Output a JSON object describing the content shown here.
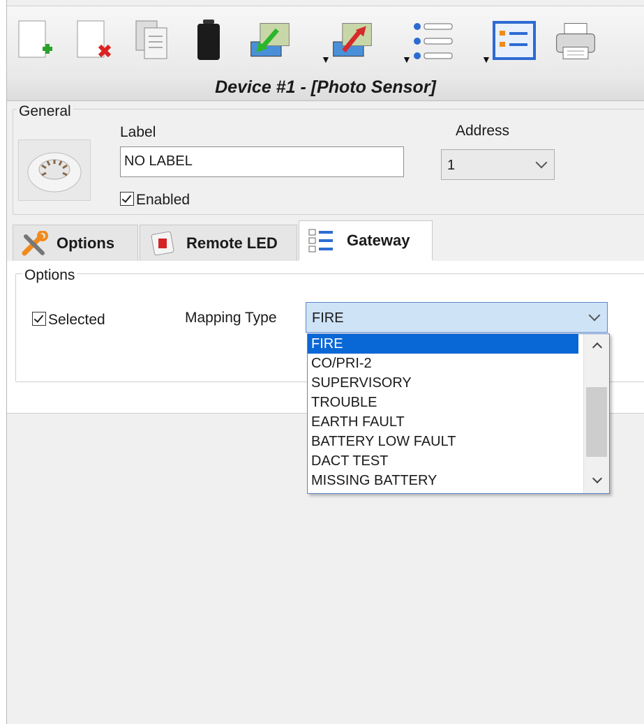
{
  "toolbar": {
    "buttons": [
      {
        "name": "new-device-icon"
      },
      {
        "name": "delete-device-icon"
      },
      {
        "name": "copy-icon"
      },
      {
        "name": "battery-icon"
      },
      {
        "name": "import-icon"
      },
      {
        "name": "export-icon"
      },
      {
        "name": "list-icon"
      },
      {
        "name": "form-view-icon"
      },
      {
        "name": "print-icon"
      }
    ]
  },
  "window_title": "Device #1 - [Photo Sensor]",
  "general": {
    "legend": "General",
    "label_caption": "Label",
    "label_value": "NO LABEL",
    "address_caption": "Address",
    "address_value": "1",
    "enabled_label": "Enabled",
    "enabled_checked": true
  },
  "tabs": [
    {
      "label": "Options",
      "icon": "tools-icon"
    },
    {
      "label": "Remote LED",
      "icon": "remote-led-icon"
    },
    {
      "label": "Gateway",
      "icon": "checklist-icon",
      "active": true
    }
  ],
  "options_group": {
    "legend": "Options",
    "selected_label": "Selected",
    "selected_checked": true,
    "mapping_type_label": "Mapping Type",
    "mapping_type_value": "FIRE",
    "mapping_options": [
      "FIRE",
      "CO/PRI-2",
      "SUPERVISORY",
      "TROUBLE",
      "EARTH FAULT",
      "BATTERY LOW FAULT",
      "DACT TEST",
      "MISSING BATTERY"
    ]
  },
  "colors": {
    "selection": "#0a67d6",
    "dropdown_open_bg": "#cfe3f7",
    "dropdown_border": "#5b87c8"
  }
}
